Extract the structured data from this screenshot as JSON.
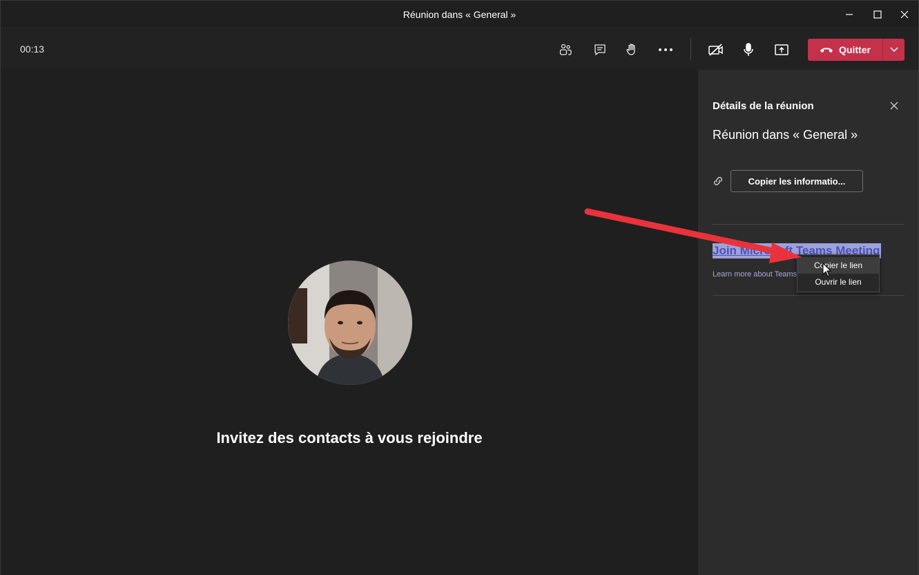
{
  "window": {
    "title": "Réunion dans « General »",
    "minimize_icon": "minimize-icon",
    "maximize_icon": "maximize-icon",
    "close_icon": "close-icon"
  },
  "meeting_bar": {
    "timer": "00:13",
    "tools": [
      "participants-icon",
      "chat-icon",
      "raise-hand-icon",
      "more-options-icon",
      "camera-off-icon",
      "microphone-icon",
      "share-screen-icon"
    ],
    "leave_label": "Quitter",
    "leave_color": "#c4314b"
  },
  "stage": {
    "invite_text": "Invitez des contacts à vous rejoindre"
  },
  "details_panel": {
    "title": "Détails de la réunion",
    "meeting_name": "Réunion dans « General »",
    "copy_button_label": "Copier les informatio...",
    "join_link_text": "Join Microsoft Teams Meeting",
    "learn_more_text": "Learn more about Teams"
  },
  "context_menu": {
    "items": [
      "Copier le lien",
      "Ouvrir le lien"
    ]
  },
  "colors": {
    "background": "#1f1f1f",
    "panel": "#2d2c2c",
    "accent_red": "#c4314b",
    "link_purple": "#4b53bc",
    "annotation_arrow": "#e8323c"
  }
}
